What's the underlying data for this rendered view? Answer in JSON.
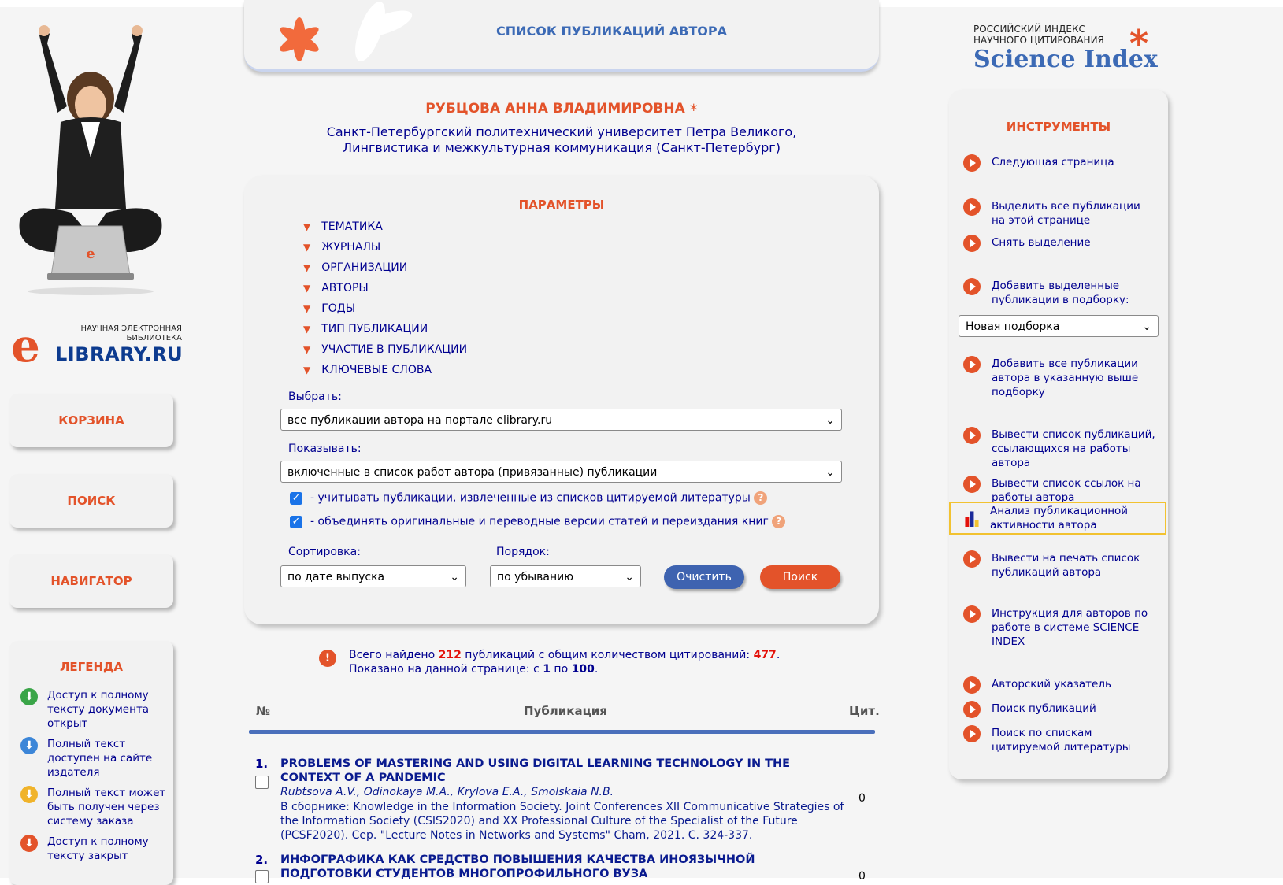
{
  "header": {
    "title": "СПИСОК ПУБЛИКАЦИЙ АВТОРА"
  },
  "logo": {
    "small": "НАУЧНАЯ ЭЛЕКТРОННАЯ БИБЛИОТЕКА",
    "letter": "e",
    "name": "LIBRARY.RU"
  },
  "science_index": {
    "line1": "РОССИЙСКИЙ ИНДЕКС",
    "line2": "НАУЧНОГО ЦИТИРОВАНИЯ",
    "name": "Science Index"
  },
  "sidebar": {
    "cart": "КОРЗИНА",
    "search": "ПОИСК",
    "navigator": "НАВИГАТОР"
  },
  "legend": {
    "title": "ЛЕГЕНДА",
    "items": [
      {
        "text": "Доступ к полному тексту документа открыт",
        "color": "#3aa548"
      },
      {
        "text": "Полный текст доступен на сайте издателя",
        "color": "#3c86d8"
      },
      {
        "text": "Полный текст может быть получен через систему заказа",
        "color": "#f0b32a"
      },
      {
        "text": "Доступ к полному тексту закрыт",
        "color": "#e3532a"
      }
    ]
  },
  "author": {
    "name": "РУБЦОВА АННА ВЛАДИМИРОВНА",
    "affiliation": "Санкт-Петербургский политехнический университет Петра Великого, Лингвистика и межкультурная коммуникация (Санкт-Петербург)"
  },
  "params": {
    "title": "ПАРАМЕТРЫ",
    "filters": [
      "ТЕМАТИКА",
      "ЖУРНАЛЫ",
      "ОРГАНИЗАЦИИ",
      "АВТОРЫ",
      "ГОДЫ",
      "ТИП ПУБЛИКАЦИИ",
      "УЧАСТИЕ В ПУБЛИКАЦИИ",
      "КЛЮЧЕВЫЕ СЛОВА"
    ],
    "select_label": "Выбрать:",
    "select_value": "все публикации автора на портале elibrary.ru",
    "show_label": "Показывать:",
    "show_value": "включенные в список работ автора (привязанные) публикации",
    "check1": "- учитывать публикации, извлеченные из списков цитируемой литературы",
    "check2": "- объединять оригинальные и переводные версии статей и переиздания книг",
    "sort_label": "Сортировка:",
    "sort_value": "по дате выпуска",
    "order_label": "Порядок:",
    "order_value": "по убыванию",
    "clear_btn": "Очистить",
    "search_btn": "Поиск"
  },
  "summary": {
    "found_prefix": "Всего найдено ",
    "found_count": "212",
    "found_mid": " публикаций с общим количеством цитирований: ",
    "cit_count": "477",
    "dot": ".",
    "shown_prefix": "Показано на данной странице: с ",
    "shown_from": "1",
    "shown_mid": " по ",
    "shown_to": "100",
    "shown_end": "."
  },
  "table": {
    "col_num": "№",
    "col_pub": "Публикация",
    "col_cit": "Цит.",
    "rows": [
      {
        "num": "1.",
        "title": "PROBLEMS OF MASTERING AND USING DIGITAL LEARNING TECHNOLOGY IN THE CONTEXT OF A PANDEMIC",
        "authors": "Rubtsova A.V., Odinokaya M.A., Krylova E.A., Smolskaia N.B.",
        "source": "В сборнике: Knowledge in the Information Society. Joint Conferences XII Communicative Strategies of the Information Society (CSIS2020) and XX Professional Culture of the Specialist of the Future (PCSF2020). Сер. \"Lecture Notes in Networks and Systems\" Cham, 2021. С. 324-337.",
        "cit": "0"
      },
      {
        "num": "2.",
        "title": "ИНФОГРАФИКА КАК СРЕДСТВО ПОВЫШЕНИЯ КАЧЕСТВА ИНОЯЗЫЧНОЙ ПОДГОТОВКИ СТУДЕНТОВ МНОГОПРОФИЛЬНОГО ВУЗА",
        "cit": "0"
      }
    ]
  },
  "tools": {
    "title": "ИНСТРУМЕНТЫ",
    "next_page": "Следующая страница",
    "select_all": "Выделить все публикации на этой странице",
    "deselect": "Снять выделение",
    "add_selected": "Добавить выделенные публикации в подборку:",
    "collection_value": "Новая подборка",
    "add_all": "Добавить все публикации автора в указанную выше подборку",
    "citing_list": "Вывести список публикаций, ссылающихся на работы автора",
    "refs_list": "Вывести список ссылок на работы автора",
    "analysis": "Анализ публикационной активности автора",
    "print_list": "Вывести на печать список публикаций автора",
    "instructions": "Инструкция для авторов по работе в системе SCIENCE INDEX",
    "author_index": "Авторский указатель",
    "pub_search": "Поиск публикаций",
    "ref_search": "Поиск по спискам цитируемой литературы"
  }
}
